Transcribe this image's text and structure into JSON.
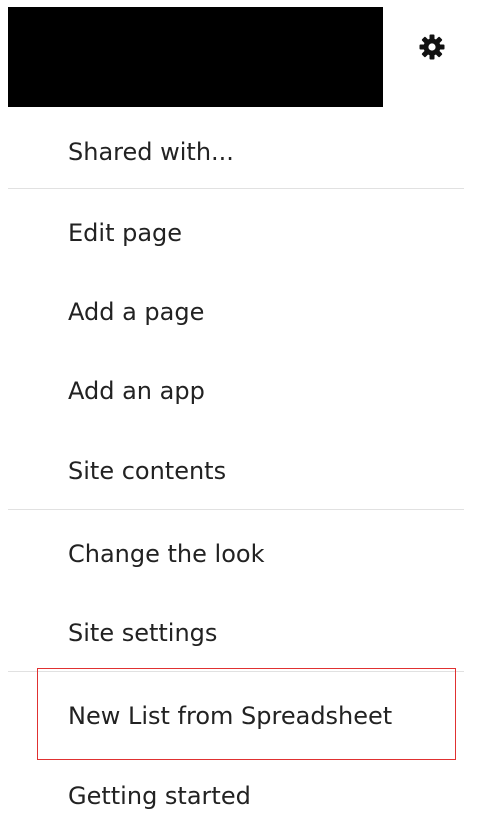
{
  "header": {
    "settings_icon": "gear-icon"
  },
  "menu": {
    "items": [
      {
        "label": "Shared with..."
      },
      {
        "label": "Edit page"
      },
      {
        "label": "Add a page"
      },
      {
        "label": "Add an app"
      },
      {
        "label": "Site contents"
      },
      {
        "label": "Change the look"
      },
      {
        "label": "Site settings"
      },
      {
        "label": "New List from Spreadsheet"
      },
      {
        "label": "Getting started"
      }
    ]
  },
  "colors": {
    "highlight": "#e03131",
    "divider": "#e1e1e1"
  }
}
